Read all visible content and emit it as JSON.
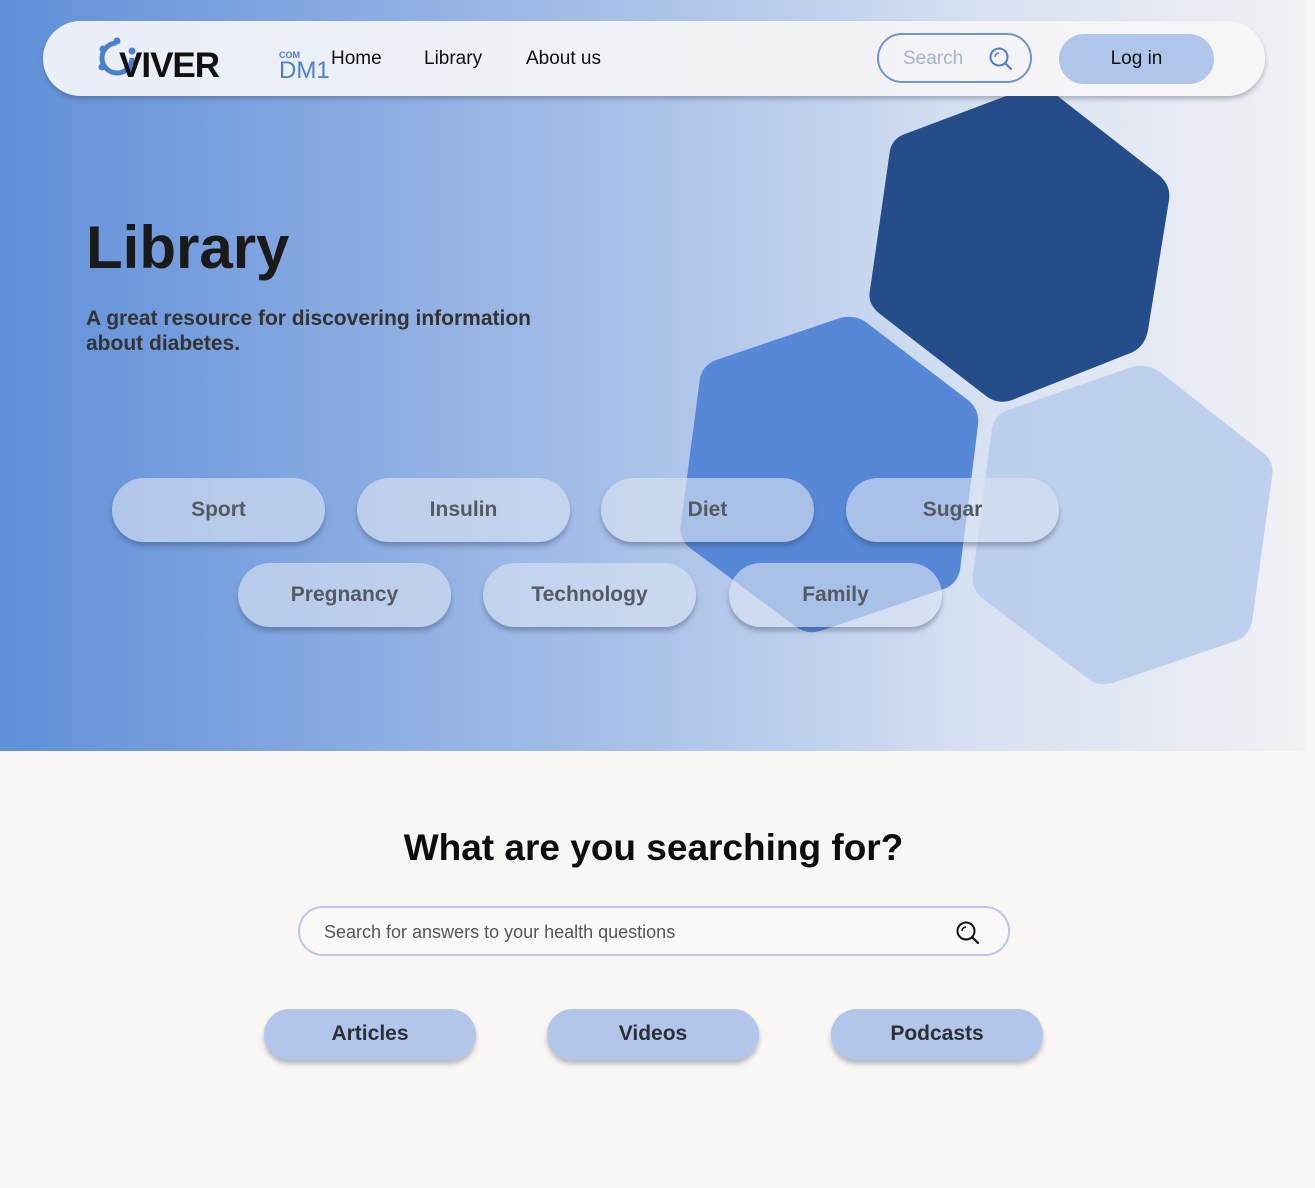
{
  "brand": {
    "wordmark": "VIVER",
    "suffix_small": "COM",
    "suffix_large": "DM1"
  },
  "nav": {
    "links": [
      "Home",
      "Library",
      "About us"
    ],
    "search_placeholder": "Search",
    "login_label": "Log in"
  },
  "hero": {
    "title": "Library",
    "subtitle": "A great resource for discovering information about diabetes."
  },
  "topics": [
    "Sport",
    "Insulin",
    "Diet",
    "Sugar",
    "Pregnancy",
    "Technology",
    "Family"
  ],
  "search_section": {
    "title": "What are you searching for?",
    "placeholder": "Search for answers to your health questions"
  },
  "content_types": [
    "Articles",
    "Videos",
    "Podcasts"
  ],
  "colors": {
    "hex_dark": "#244d89",
    "hex_mid": "#5788d7",
    "hex_light": "#b9cdec",
    "button_fill": "#b2c6ea",
    "accent": "#4a7fd0"
  },
  "icons": {
    "nav_search": "search-icon",
    "main_search": "search-icon",
    "logo": "logo-mark-icon"
  }
}
